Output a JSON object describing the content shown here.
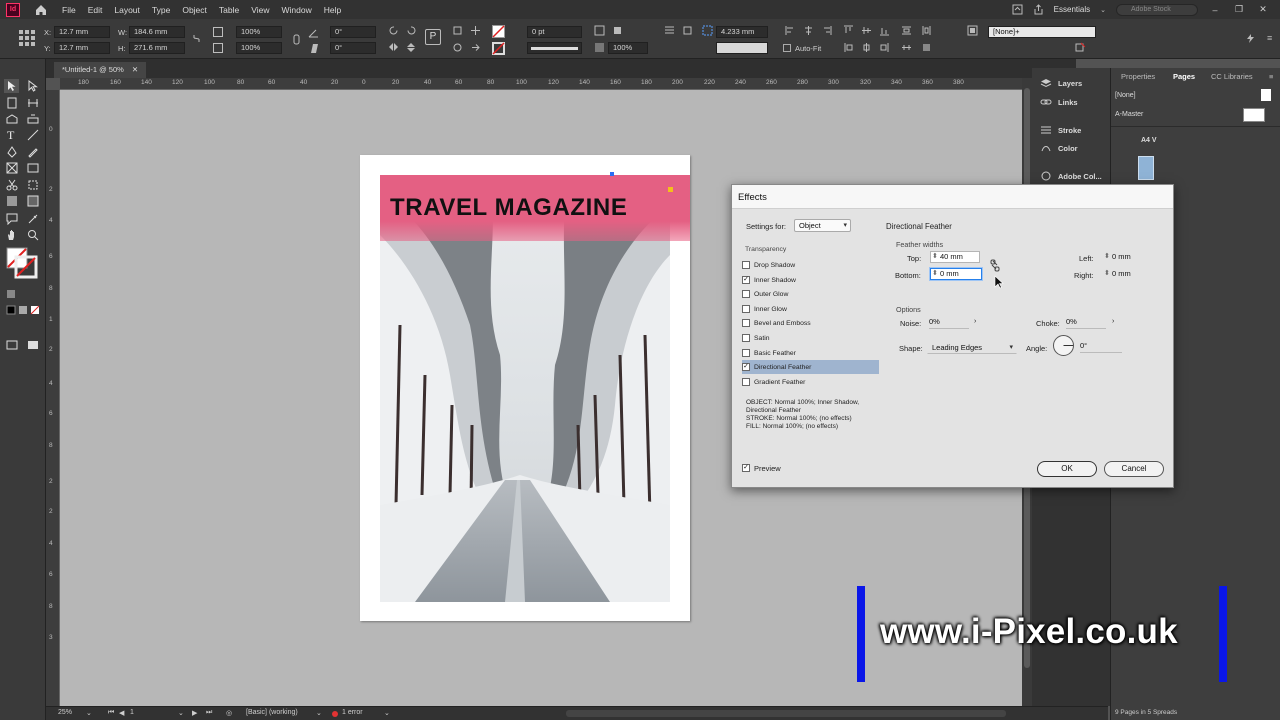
{
  "menu": {
    "app_logo": "Id",
    "items": [
      "File",
      "Edit",
      "Layout",
      "Type",
      "Object",
      "Table",
      "View",
      "Window",
      "Help"
    ],
    "workspace": "Essentials",
    "stock_search_placeholder": "Adobe Stock"
  },
  "control": {
    "x_label": "X:",
    "x": "12.7 mm",
    "y_label": "Y:",
    "y": "12.7 mm",
    "w_label": "W:",
    "w": "184.6 mm",
    "h_label": "H:",
    "h": "271.6 mm",
    "scale_x": "100%",
    "scale_y": "100%",
    "rotate": "0°",
    "shear": "0°",
    "stroke_weight": "0 pt",
    "opacity": "100%",
    "spacing": "4.233 mm",
    "auto_fit": "Auto-Fit",
    "style": "[None]+"
  },
  "document": {
    "tab_title": "*Untitled-1 @ 50%"
  },
  "ruler": {
    "h_ticks": [
      "180",
      "160",
      "140",
      "120",
      "100",
      "80",
      "60",
      "40",
      "20",
      "0",
      "20",
      "40",
      "60",
      "80",
      "100",
      "120",
      "140",
      "160",
      "180",
      "200",
      "220",
      "240",
      "260",
      "280",
      "300",
      "320",
      "340",
      "360",
      "380"
    ],
    "v_ticks": [
      "0",
      "2",
      "4",
      "6",
      "8",
      "1",
      "2",
      "4",
      "6",
      "8",
      "2",
      "2",
      "4",
      "6",
      "8",
      "3"
    ]
  },
  "canvas": {
    "banner_title": "TRAVEL MAGAZINE"
  },
  "status": {
    "zoom": "25%",
    "page": "1",
    "profile": "[Basic] (working)",
    "errors": "1 error"
  },
  "side_panels": {
    "layers": "Layers",
    "links": "Links",
    "stroke": "Stroke",
    "color": "Color",
    "adobe_color": "Adobe Col...",
    "tab_properties": "Properties",
    "tab_pages": "Pages",
    "tab_cc": "CC Libraries",
    "none_master": "[None]",
    "a_master": "A-Master",
    "page_size": "A4 V",
    "pages_summary": "9 Pages in 5 Spreads"
  },
  "dialog": {
    "title": "Effects",
    "settings_for_label": "Settings for:",
    "settings_for_value": "Object",
    "transparency_label": "Transparency",
    "effects": [
      {
        "label": "Drop Shadow",
        "checked": false,
        "selected": false
      },
      {
        "label": "Inner Shadow",
        "checked": true,
        "selected": false
      },
      {
        "label": "Outer Glow",
        "checked": false,
        "selected": false
      },
      {
        "label": "Inner Glow",
        "checked": false,
        "selected": false
      },
      {
        "label": "Bevel and Emboss",
        "checked": false,
        "selected": false
      },
      {
        "label": "Satin",
        "checked": false,
        "selected": false
      },
      {
        "label": "Basic Feather",
        "checked": false,
        "selected": false
      },
      {
        "label": "Directional Feather",
        "checked": true,
        "selected": true
      },
      {
        "label": "Gradient Feather",
        "checked": false,
        "selected": false
      }
    ],
    "summary": [
      "OBJECT: Normal 100%; Inner Shadow,",
      "Directional Feather",
      "STROKE: Normal 100%; (no effects)",
      "FILL: Normal 100%; (no effects)"
    ],
    "section_title": "Directional Feather",
    "feather_widths_label": "Feather widths",
    "top_label": "Top:",
    "top_value": "40 mm",
    "bottom_label": "Bottom:",
    "bottom_value": "0 mm",
    "left_label": "Left:",
    "left_value": "0 mm",
    "right_label": "Right:",
    "right_value": "0 mm",
    "options_label": "Options",
    "noise_label": "Noise:",
    "noise_value": "0%",
    "choke_label": "Choke:",
    "choke_value": "0%",
    "shape_label": "Shape:",
    "shape_value": "Leading Edges",
    "angle_label": "Angle:",
    "angle_value": "0°",
    "preview_label": "Preview",
    "preview_checked": true,
    "ok_label": "OK",
    "cancel_label": "Cancel"
  },
  "watermark": {
    "text": "www.i-Pixel.co.uk"
  },
  "colors": {
    "banner": "#e46083",
    "watermark_bar": "#0a16e8",
    "selection": "#9fb4cf"
  }
}
